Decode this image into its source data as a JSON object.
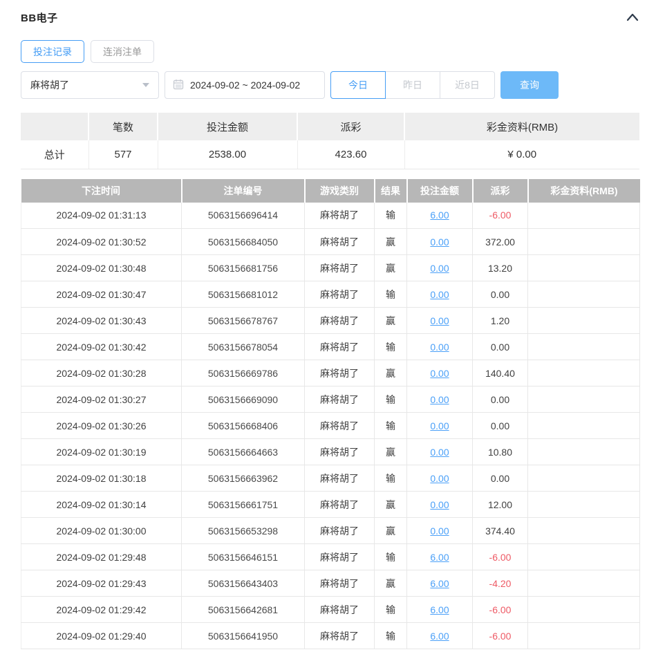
{
  "page": {
    "title": "BB电子"
  },
  "icons": {
    "collapse": "chevron-up-icon",
    "calendar": "calendar-icon",
    "select_caret": "caret-down-icon"
  },
  "tabs": [
    {
      "label": "投注记录",
      "active": true
    },
    {
      "label": "连消注单",
      "active": false
    }
  ],
  "filters": {
    "game_select_value": "麻将胡了",
    "date_range_value": "2024-09-02 ~ 2024-09-02",
    "quick_buttons": [
      {
        "label": "今日",
        "active": true
      },
      {
        "label": "昨日",
        "active": false
      },
      {
        "label": "近8日",
        "active": false
      }
    ],
    "query_label": "查询"
  },
  "summary": {
    "headers": [
      "",
      "笔数",
      "投注金额",
      "派彩",
      "彩金资料(RMB)"
    ],
    "row_label": "总计",
    "count": "577",
    "bet_amount": "2538.00",
    "payout": "423.60",
    "bonus": "¥ 0.00"
  },
  "table": {
    "headers": [
      "下注时间",
      "注单编号",
      "游戏类别",
      "结果",
      "投注金额",
      "派彩",
      "彩金资料(RMB)"
    ],
    "rows": [
      {
        "time": "2024-09-02 01:31:13",
        "order_id": "5063156696414",
        "game": "麻将胡了",
        "result": "输",
        "bet": "6.00",
        "payout": "-6.00",
        "bonus": ""
      },
      {
        "time": "2024-09-02 01:30:52",
        "order_id": "5063156684050",
        "game": "麻将胡了",
        "result": "赢",
        "bet": "0.00",
        "payout": "372.00",
        "bonus": ""
      },
      {
        "time": "2024-09-02 01:30:48",
        "order_id": "5063156681756",
        "game": "麻将胡了",
        "result": "赢",
        "bet": "0.00",
        "payout": "13.20",
        "bonus": ""
      },
      {
        "time": "2024-09-02 01:30:47",
        "order_id": "5063156681012",
        "game": "麻将胡了",
        "result": "输",
        "bet": "0.00",
        "payout": "0.00",
        "bonus": ""
      },
      {
        "time": "2024-09-02 01:30:43",
        "order_id": "5063156678767",
        "game": "麻将胡了",
        "result": "赢",
        "bet": "0.00",
        "payout": "1.20",
        "bonus": ""
      },
      {
        "time": "2024-09-02 01:30:42",
        "order_id": "5063156678054",
        "game": "麻将胡了",
        "result": "输",
        "bet": "0.00",
        "payout": "0.00",
        "bonus": ""
      },
      {
        "time": "2024-09-02 01:30:28",
        "order_id": "5063156669786",
        "game": "麻将胡了",
        "result": "赢",
        "bet": "0.00",
        "payout": "140.40",
        "bonus": ""
      },
      {
        "time": "2024-09-02 01:30:27",
        "order_id": "5063156669090",
        "game": "麻将胡了",
        "result": "输",
        "bet": "0.00",
        "payout": "0.00",
        "bonus": ""
      },
      {
        "time": "2024-09-02 01:30:26",
        "order_id": "5063156668406",
        "game": "麻将胡了",
        "result": "输",
        "bet": "0.00",
        "payout": "0.00",
        "bonus": ""
      },
      {
        "time": "2024-09-02 01:30:19",
        "order_id": "5063156664663",
        "game": "麻将胡了",
        "result": "赢",
        "bet": "0.00",
        "payout": "10.80",
        "bonus": ""
      },
      {
        "time": "2024-09-02 01:30:18",
        "order_id": "5063156663962",
        "game": "麻将胡了",
        "result": "输",
        "bet": "0.00",
        "payout": "0.00",
        "bonus": ""
      },
      {
        "time": "2024-09-02 01:30:14",
        "order_id": "5063156661751",
        "game": "麻将胡了",
        "result": "赢",
        "bet": "0.00",
        "payout": "12.00",
        "bonus": ""
      },
      {
        "time": "2024-09-02 01:30:00",
        "order_id": "5063156653298",
        "game": "麻将胡了",
        "result": "赢",
        "bet": "0.00",
        "payout": "374.40",
        "bonus": ""
      },
      {
        "time": "2024-09-02 01:29:48",
        "order_id": "5063156646151",
        "game": "麻将胡了",
        "result": "输",
        "bet": "6.00",
        "payout": "-6.00",
        "bonus": ""
      },
      {
        "time": "2024-09-02 01:29:43",
        "order_id": "5063156643403",
        "game": "麻将胡了",
        "result": "赢",
        "bet": "6.00",
        "payout": "-4.20",
        "bonus": ""
      },
      {
        "time": "2024-09-02 01:29:42",
        "order_id": "5063156642681",
        "game": "麻将胡了",
        "result": "输",
        "bet": "6.00",
        "payout": "-6.00",
        "bonus": ""
      },
      {
        "time": "2024-09-02 01:29:40",
        "order_id": "5063156641950",
        "game": "麻将胡了",
        "result": "输",
        "bet": "6.00",
        "payout": "-6.00",
        "bonus": ""
      }
    ]
  },
  "colors": {
    "primary": "#459df5",
    "link": "#4ba0f8",
    "negative": "#ee5a65",
    "table_header_bg": "#b7b7b7",
    "query_button_bg": "#6db9f8"
  }
}
